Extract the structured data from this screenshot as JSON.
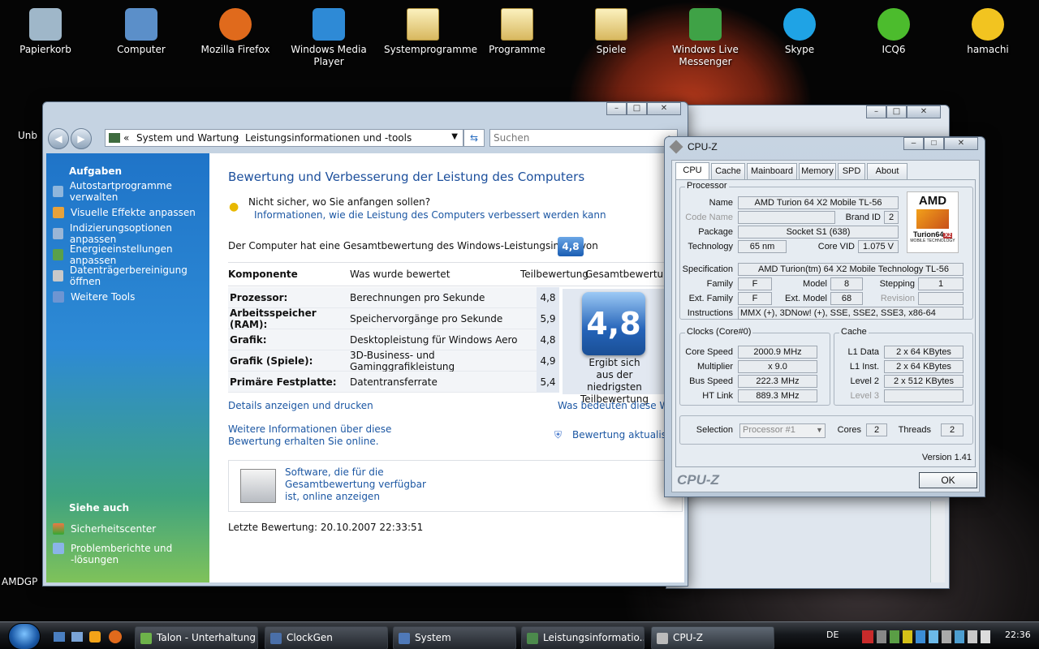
{
  "desktop_icons": [
    {
      "label": "Papierkorb",
      "icon": "recycle-bin-icon",
      "color": "#9fb7c9"
    },
    {
      "label": "Computer",
      "icon": "computer-icon",
      "color": "#5b8fc9"
    },
    {
      "label": "Mozilla Firefox",
      "icon": "firefox-icon",
      "color": "#e06a1c"
    },
    {
      "label": "Windows Media Player",
      "icon": "media-player-icon",
      "color": "#2e8ad6"
    },
    {
      "label": "Systemprogramme",
      "icon": "folder-icon",
      "color": "#e6c86a"
    },
    {
      "label": "Programme",
      "icon": "folder-icon",
      "color": "#e6c86a"
    },
    {
      "label": "Spiele",
      "icon": "folder-icon",
      "color": "#e6c86a"
    },
    {
      "label": "Windows Live Messenger",
      "icon": "messenger-icon",
      "color": "#3fa246"
    },
    {
      "label": "Skype",
      "icon": "skype-icon",
      "color": "#1fa3e5"
    },
    {
      "label": "ICQ6",
      "icon": "icq-flower-icon",
      "color": "#4cbc2d"
    },
    {
      "label": "hamachi",
      "icon": "hamachi-icon",
      "color": "#f2c420"
    }
  ],
  "desktop_partial": {
    "unb": "Unb",
    "amdgp": "AMDGP"
  },
  "perf": {
    "address": {
      "chev": "«",
      "crumb1": "System und Wartung",
      "sep": "›",
      "crumb2": "Leistungsinformationen und -tools",
      "search_placeholder": "Suchen"
    },
    "sidebar": {
      "tasks_title": "Aufgaben",
      "tasks": [
        "Autostartprogramme verwalten",
        "Visuelle Effekte anpassen",
        "Indizierungsoptionen anpassen",
        "Energieeinstellungen anpassen",
        "Datenträgerbereinigung öffnen",
        "Weitere Tools"
      ],
      "see_also_title": "Siehe auch",
      "see_also": [
        "Sicherheitscenter",
        "Problemberichte und -lösungen"
      ]
    },
    "title": "Bewertung und Verbesserung der Leistung des Computers",
    "hint": "Nicht sicher, wo Sie anfangen sollen?",
    "hint_link": "Informationen, wie die Leistung des Computers verbessert werden kann",
    "index_text": "Der Computer hat eine Gesamtbewertung des Windows-Leistungsindex von",
    "index_value": "4,8",
    "columns": [
      "Komponente",
      "Was wurde bewertet",
      "Teilbewertung",
      "Gesamtbewertung"
    ],
    "rows": [
      {
        "k": "Prozessor:",
        "d": "Berechnungen pro Sekunde",
        "s": "4,8"
      },
      {
        "k": "Arbeitsspeicher (RAM):",
        "d": "Speichervorgänge pro Sekunde",
        "s": "5,9"
      },
      {
        "k": "Grafik:",
        "d": "Desktopleistung für Windows Aero",
        "s": "4,8"
      },
      {
        "k": "Grafik (Spiele):",
        "d": "3D-Business- und Gaminggrafikleistung",
        "s": "4,9"
      },
      {
        "k": "Primäre Festplatte:",
        "d": "Datentransferrate",
        "s": "5,4"
      }
    ],
    "badge_value": "4,8",
    "badge_caption": "Ergibt sich aus der niedrigsten Teilbewertung",
    "link_details": "Details anzeigen und drucken",
    "link_meaning": "Was bedeuten diese Wert",
    "link_more": "Weitere Informationen über diese Bewertung erhalten Sie online.",
    "link_update": "Bewertung aktualisier",
    "software_text": "Software, die für die Gesamtbewertung verfügbar ist, online anzeigen",
    "last_eval": "Letzte Bewertung: 20.10.2007 22:33:51"
  },
  "cpuz": {
    "title": "CPU-Z",
    "tabs": [
      "CPU",
      "Cache",
      "Mainboard",
      "Memory",
      "SPD",
      "About"
    ],
    "processor_group": "Processor",
    "name_label": "Name",
    "name": "AMD Turion 64 X2 Mobile TL-56",
    "codename_label": "Code Name",
    "codename": "",
    "brandid_label": "Brand ID",
    "brandid": "2",
    "package_label": "Package",
    "package": "Socket S1 (638)",
    "tech_label": "Technology",
    "tech": "65 nm",
    "corevid_label": "Core VID",
    "corevid": "1.075 V",
    "spec_label": "Specification",
    "spec": "AMD Turion(tm) 64 X2 Mobile Technology TL-56",
    "family_label": "Family",
    "family": "F",
    "model_label": "Model",
    "model": "8",
    "stepping_label": "Stepping",
    "stepping": "1",
    "extfamily_label": "Ext. Family",
    "extfamily": "F",
    "extmodel_label": "Ext. Model",
    "extmodel": "68",
    "revision_label": "Revision",
    "revision": "",
    "instr_label": "Instructions",
    "instr": "MMX (+), 3DNow! (+), SSE, SSE2, SSE3, x86-64",
    "logo_brand": "AMD",
    "logo_sub": "Turion64",
    "logo_sub2": "X2",
    "logo_small": "MOBILE TECHNOLOGY",
    "clocks_group": "Clocks (Core#0)",
    "core_speed_label": "Core Speed",
    "core_speed": "2000.9 MHz",
    "mult_label": "Multiplier",
    "mult": "x 9.0",
    "bus_label": "Bus Speed",
    "bus": "222.3 MHz",
    "ht_label": "HT Link",
    "ht": "889.3 MHz",
    "cache_group": "Cache",
    "l1d_label": "L1 Data",
    "l1d": "2 x 64 KBytes",
    "l1i_label": "L1 Inst.",
    "l1i": "2 x 64 KBytes",
    "l2_label": "Level 2",
    "l2": "2 x 512 KBytes",
    "l3_label": "Level 3",
    "l3": "",
    "selection_label": "Selection",
    "selection": "Processor #1",
    "cores_label": "Cores",
    "cores": "2",
    "threads_label": "Threads",
    "threads": "2",
    "version": "Version 1.41",
    "brand_footer": "CPU-Z",
    "ok": "OK"
  },
  "taskbar": {
    "items": [
      "Talon - Unterhaltung",
      "ClockGen",
      "System",
      "Leistungsinformatio...",
      "CPU-Z"
    ],
    "lang": "DE",
    "time": "22:36"
  }
}
